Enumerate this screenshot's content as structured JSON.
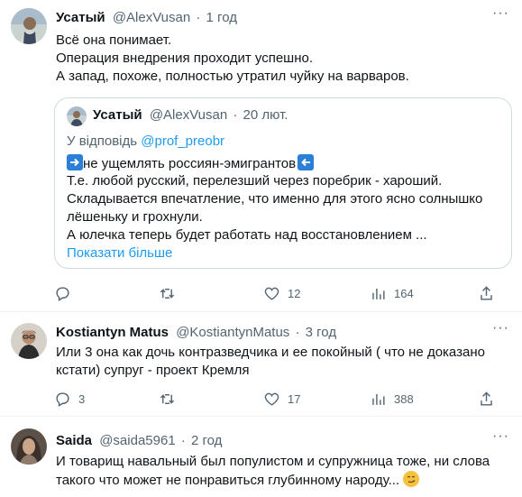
{
  "tweets": [
    {
      "name": "Усатый",
      "handle": "@AlexVusan",
      "sep": "·",
      "time": "1 год",
      "lines": [
        "Всё она понимает.",
        "Операция внедрения проходит успешно.",
        "А запад, похоже, полностью утратил чуйку на варваров."
      ],
      "quote": {
        "name": "Усатый",
        "handle": "@AlexVusan",
        "sep": "·",
        "time": "20 лют.",
        "reply_prefix": "У відповідь ",
        "reply_handle": "@prof_preobr",
        "line1": "не ущемлять россиян-эмигрантов",
        "lines": [
          "Т.е. любой русский, перелезший через поребрик - хароший.",
          "Складывается впечатление, что именно для этого ясно солнышко",
          "лёшеньку и грохнули.",
          "А юлечка теперь будет работать над восстановлением ..."
        ],
        "show_more": "Показати більше"
      },
      "actions": {
        "replies": "",
        "retweets": "",
        "likes": "12",
        "views": "164"
      }
    },
    {
      "name": "Kostiantyn Matus",
      "handle": "@KostiantynMatus",
      "sep": "·",
      "time": "3 год",
      "lines": [
        "Или 3 она как дочь контразведчика и ее покойный ( что не доказано",
        "кстати) супруг - проект Кремля"
      ],
      "actions": {
        "replies": "3",
        "retweets": "",
        "likes": "17",
        "views": "388"
      }
    },
    {
      "name": "Saida",
      "handle": "@saida5961",
      "sep": "·",
      "time": "2 год",
      "lines": [
        "И товарищ навальный был популистом и супружница тоже, ни слова",
        "такого что может не понравиться глубинному народу..."
      ]
    }
  ],
  "icons": {
    "more": "more-dots-icon",
    "reply": "reply-icon",
    "retweet": "retweet-icon",
    "like": "heart-icon",
    "views": "views-icon",
    "share": "share-icon"
  },
  "colors": {
    "muted": "#536471",
    "link": "#1d9bf0",
    "divider": "#eff3f4",
    "border": "#cfd9de"
  }
}
